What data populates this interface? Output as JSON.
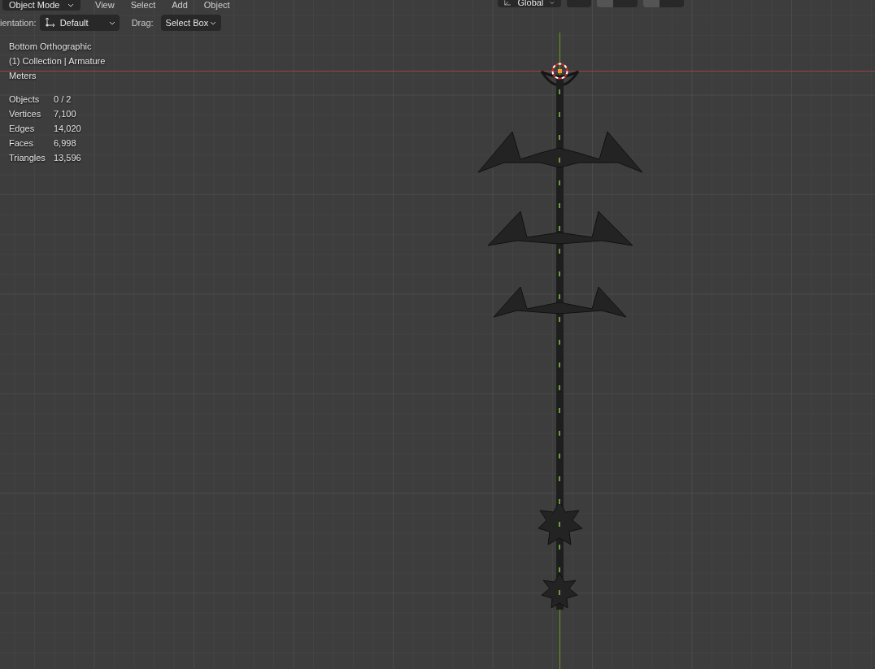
{
  "header": {
    "mode": "Object Mode",
    "menus": [
      "View",
      "Select",
      "Add",
      "Object"
    ],
    "transform_orientation": "Global",
    "snap": {
      "on": true
    },
    "proportional_edit": {
      "on": true
    }
  },
  "tool_settings": {
    "orientation_label": "ientation:",
    "orientation_value": "Default",
    "drag_label": "Drag:",
    "drag_value": "Select Box"
  },
  "overlay": {
    "view_name": "Bottom Orthographic",
    "collection": "(1) Collection | Armature",
    "units": "Meters"
  },
  "stats": [
    {
      "label": "Objects",
      "value": "0 / 2"
    },
    {
      "label": "Vertices",
      "value": "7,100"
    },
    {
      "label": "Edges",
      "value": "14,020"
    },
    {
      "label": "Faces",
      "value": "6,998"
    },
    {
      "label": "Triangles",
      "value": "13,596"
    }
  ]
}
